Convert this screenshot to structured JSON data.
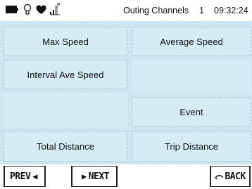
{
  "status": {
    "icons": [
      "battery-icon",
      "bulb-icon",
      "heart-icon",
      "signal-icon"
    ],
    "channel_label": "Outing Channels",
    "channel_number": "1",
    "time": "09:32:24"
  },
  "fields": {
    "max_speed": "Max Speed",
    "average_speed": "Average Speed",
    "interval_ave_speed": "Interval Ave Speed",
    "event": "Event",
    "total_distance": "Total Distance",
    "trip_distance": "Trip Distance"
  },
  "buttons": {
    "prev": "PREV",
    "next": "NEXT",
    "back": "BACK"
  },
  "colors": {
    "cell_bg": "#d6ecf5",
    "screen_bg": "#cfe6f0",
    "bar_bg": "#ffffff"
  }
}
